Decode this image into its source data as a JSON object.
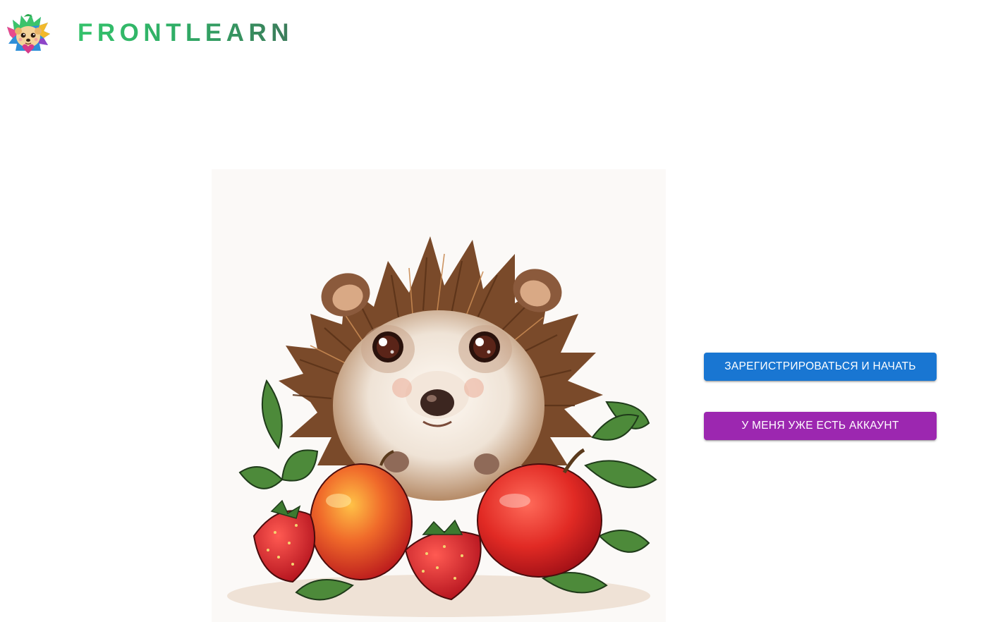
{
  "header": {
    "brand": "FRONTLEARN",
    "logo_icon": "hedgehog-mascot-icon"
  },
  "hero": {
    "image": "hedgehog-with-apples-and-strawberries-illustration"
  },
  "actions": {
    "register_label": "Зарегистрироваться и начать",
    "login_label": "У меня уже есть аккаунт"
  },
  "colors": {
    "brand_green": "#34c26b",
    "register_button": "#1976d2",
    "login_button": "#9c27b0"
  }
}
